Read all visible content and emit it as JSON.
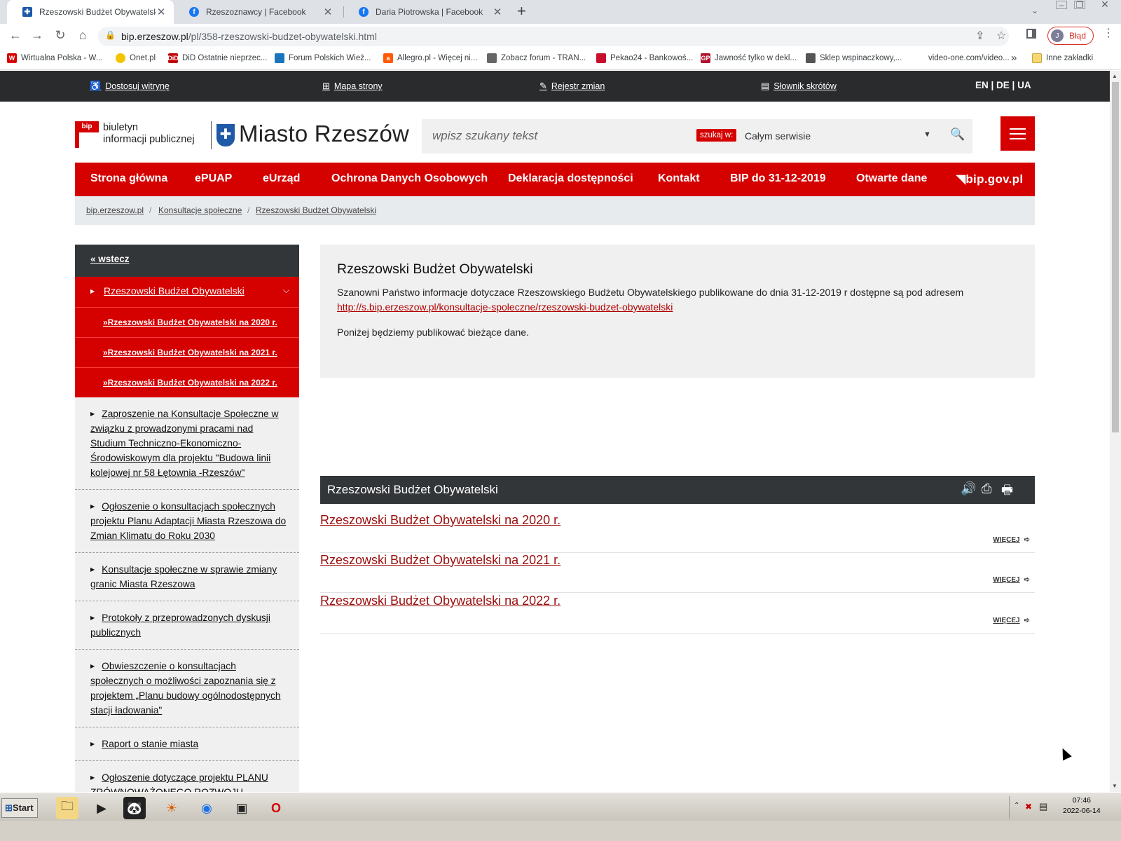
{
  "browser": {
    "tabs": [
      {
        "title": "Rzeszowski Budżet Obywatelski - Bi",
        "favicon": "bip-favicon",
        "active": true
      },
      {
        "title": "Rzeszoznawcy | Facebook",
        "favicon": "facebook-favicon",
        "active": false
      },
      {
        "title": "Daria Piotrowska | Facebook",
        "favicon": "facebook-favicon",
        "active": false
      }
    ],
    "url_host": "bip.erzeszow.pl",
    "url_path": "/pl/358-rzeszowski-budzet-obywatelski.html",
    "profile_initial": "J",
    "profile_status": "Błąd",
    "bookmarks": [
      {
        "label": "Wirtualna Polska - W...",
        "color": "#d50000",
        "glyph": "W"
      },
      {
        "label": "Onet.pl",
        "color": "#f5c400",
        "glyph": ""
      },
      {
        "label": "DiD Ostatnie nieprzec...",
        "color": "#c00000",
        "glyph": "DiD"
      },
      {
        "label": "Forum Polskich Wież...",
        "color": "#1b75bb",
        "glyph": ""
      },
      {
        "label": "Allegro.pl - Więcej ni...",
        "color": "#ff5a00",
        "glyph": "a"
      },
      {
        "label": "Zobacz forum - TRAN...",
        "color": "#666666",
        "glyph": ""
      },
      {
        "label": "Pekao24 - Bankowoś...",
        "color": "#c8102e",
        "glyph": ""
      },
      {
        "label": "Jawność tylko w dekl...",
        "color": "#b0102e",
        "glyph": "GP"
      },
      {
        "label": "Sklep wspinaczkowy,...",
        "color": "#555555",
        "glyph": ""
      },
      {
        "label": "video-one.com/video...",
        "color": "#ffffff",
        "glyph": ""
      }
    ],
    "bookmarks_more": "»",
    "other_bookmarks": "Inne zakładki"
  },
  "accessibility_bar": {
    "items": [
      "Dostosuj witrynę",
      "Mapa strony",
      "Rejestr zmian",
      "Słownik skrótów"
    ],
    "languages": "EN |  DE  |  UA"
  },
  "header": {
    "bip_flag": "bip",
    "bip_line1": "biuletyn",
    "bip_line2": "informacji publicznej",
    "city_name": "Miasto Rzeszów",
    "search_placeholder": "wpisz szukany tekst",
    "search_in_label": "szukaj w:",
    "search_scope": "Całym serwisie"
  },
  "main_nav": [
    "Strona główna",
    "ePUAP",
    "eUrząd",
    "Ochrona Danych Osobowych",
    "Deklaracja dostępności",
    "Kontakt",
    "BIP do 31-12-2019",
    "Otwarte dane",
    "bip.gov.pl"
  ],
  "breadcrumbs": [
    "bip.erzeszow.pl",
    "Konsultacje społeczne",
    "Rzeszowski Budżet Obywatelski"
  ],
  "sidebar": {
    "back_label": "« wstecz",
    "active_section": "Rzeszowski Budżet Obywatelski",
    "active_sub": [
      "»Rzeszowski Budżet Obywatelski na 2020 r.",
      "»Rzeszowski Budżet Obywatelski na 2021 r.",
      "»Rzeszowski Budżet Obywatelski na 2022 r."
    ],
    "items": [
      "Zaproszenie na Konsultacje Społeczne w związku z prowadzonymi pracami nad Studium Techniczno-Ekonomiczno-Środowiskowym dla projektu \"Budowa linii kolejowej nr 58 Łętownia -Rzeszów\"",
      "Ogłoszenie o konsultacjach społecznych projektu Planu Adaptacji Miasta Rzeszowa do Zmian Klimatu do Roku 2030",
      "Konsultacje społeczne w sprawie zmiany granic Miasta Rzeszowa",
      "Protokoły z przeprowadzonych dyskusji publicznych",
      "Obwieszczenie o konsultacjach społecznych o możliwości zapoznania się z projektem „Planu budowy ogólnodostępnych stacji ładowania\"",
      "Raport o stanie miasta",
      "Ogłoszenie dotyczące projektu PLANU ZRÓWNOWAŻONEGO ROZWOJU PUBLICZNEGO TRANSPORTU"
    ]
  },
  "content": {
    "title": "Rzeszowski Budżet Obywatelski",
    "intro": "Szanowni Państwo informacje dotyczace Rzeszowskiego Budżetu Obywatelskiego publikowane do dnia 31-12-2019 r dostępne są pod adresem",
    "intro_link": "http://s.bip.erzeszow.pl/konsultacje-spoleczne/rzeszowski-budzet-obywatelski",
    "note": "Poniżej będziemy publikować bieżące dane.",
    "list_title": "Rzeszowski Budżet Obywatelski",
    "entries": [
      "Rzeszowski Budżet Obywatelski na 2020 r.",
      "Rzeszowski Budżet Obywatelski na 2021 r.",
      "Rzeszowski Budżet Obywatelski na 2022 r."
    ],
    "more_label": "WIĘCEJ"
  },
  "taskbar": {
    "start_label": "Start",
    "time": "07:46",
    "date": "2022-06-14"
  },
  "colors": {
    "brand_red": "#d50000",
    "dark_bar": "#2a2b2d",
    "link_dark_red": "#9b0d0d"
  }
}
